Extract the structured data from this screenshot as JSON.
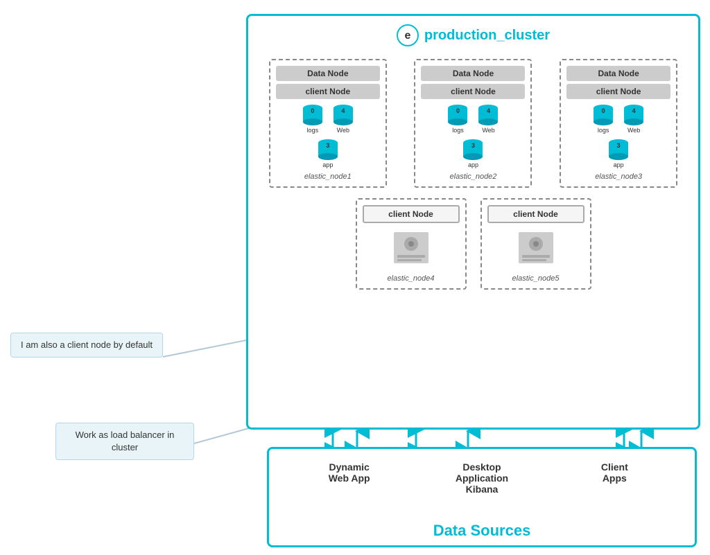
{
  "cluster": {
    "title": "production_cluster",
    "nodes_row1": [
      {
        "id": "elastic_node1",
        "label": "elastic_node1",
        "types": [
          "Data Node",
          "client Node"
        ],
        "dbs_top": [
          {
            "num": "0",
            "label": "logs"
          },
          {
            "num": "4",
            "label": "Web"
          }
        ],
        "dbs_bottom": [
          {
            "num": "3",
            "label": "app"
          }
        ]
      },
      {
        "id": "elastic_node2",
        "label": "elastic_node2",
        "types": [
          "Data Node",
          "client Node"
        ],
        "dbs_top": [
          {
            "num": "0",
            "label": "logs"
          },
          {
            "num": "4",
            "label": "Web"
          }
        ],
        "dbs_bottom": [
          {
            "num": "3",
            "label": "app"
          }
        ]
      },
      {
        "id": "elastic_node3",
        "label": "elastic_node3",
        "types": [
          "Data Node",
          "client Node"
        ],
        "dbs_top": [
          {
            "num": "0",
            "label": "logs"
          },
          {
            "num": "4",
            "label": "Web"
          }
        ],
        "dbs_bottom": [
          {
            "num": "3",
            "label": "app"
          }
        ]
      }
    ],
    "nodes_row2": [
      {
        "id": "elastic_node4",
        "label": "elastic_node4",
        "type": "client Node"
      },
      {
        "id": "elastic_node5",
        "label": "elastic_node5",
        "type": "client Node"
      }
    ]
  },
  "datasources": {
    "title": "Data Sources",
    "items": [
      {
        "label": "Dynamic\nWeb App"
      },
      {
        "label": "Desktop\nApplication\nKibana"
      },
      {
        "label": "Client\nApps"
      }
    ]
  },
  "callouts": [
    {
      "id": "callout1",
      "text": "I am also a client node by default"
    },
    {
      "id": "callout2",
      "text": "Work as load balancer in cluster"
    }
  ]
}
